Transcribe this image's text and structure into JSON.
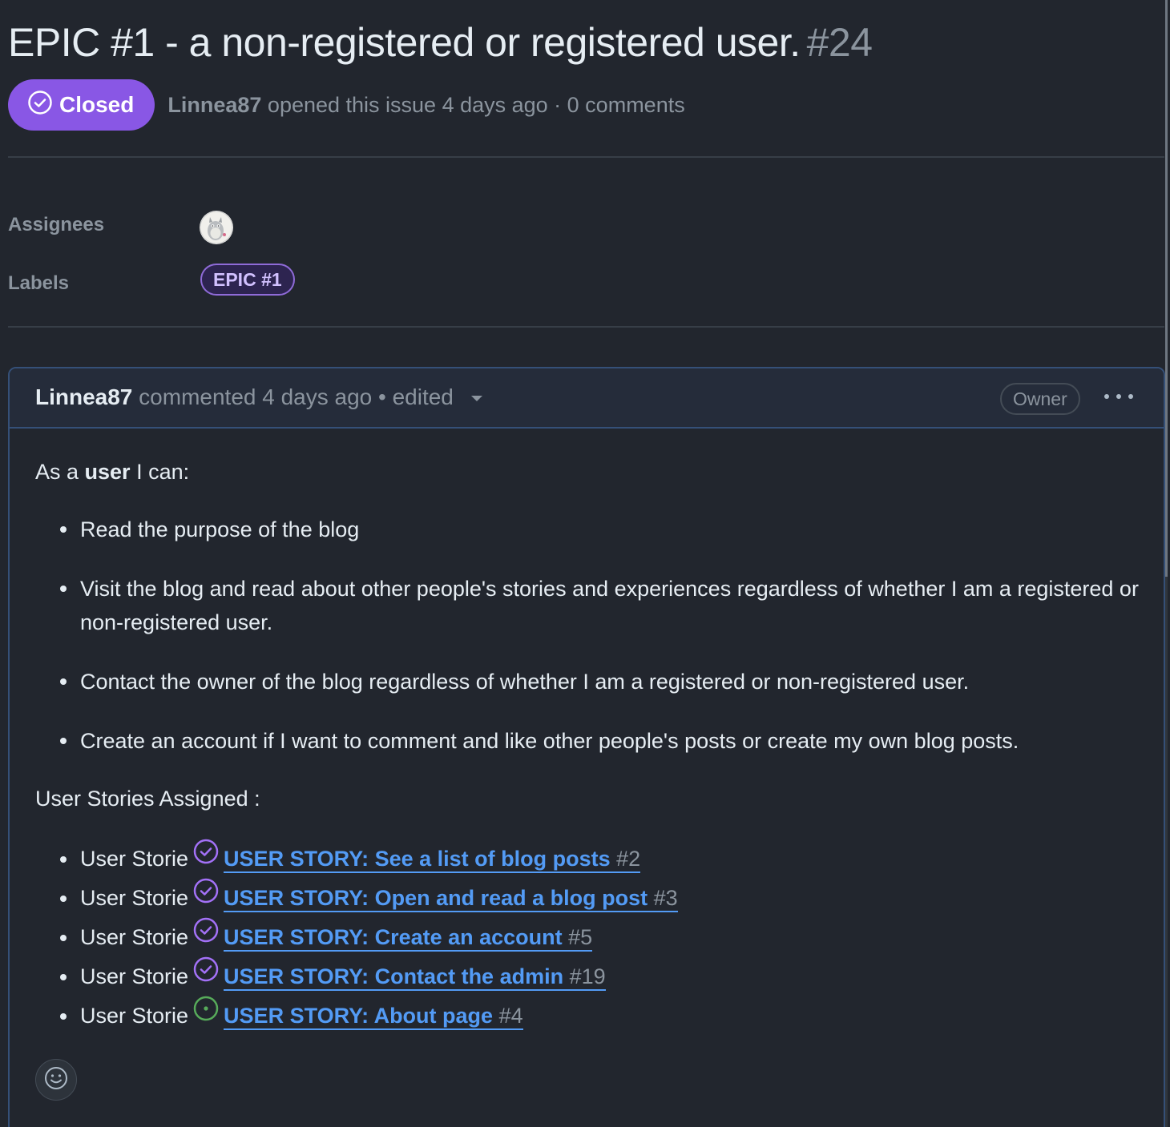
{
  "issue": {
    "title": "EPIC #1 - a non-registered or registered user.",
    "number": "#24",
    "state_label": "Closed",
    "state_color": "#8957e5",
    "author": "Linnea87",
    "meta_text": "opened this issue 4 days ago · 0 comments"
  },
  "sidebar": {
    "assignees_label": "Assignees",
    "labels_label": "Labels",
    "label_name": "EPIC #1",
    "label_color": "#8f6bd8"
  },
  "comment": {
    "author": "Linnea87",
    "meta_text": "commented 4 days ago • edited",
    "role_badge": "Owner",
    "intro_prefix": "As a ",
    "intro_bold": "user",
    "intro_suffix": " I can:",
    "requirements": [
      "Read the purpose of the blog",
      "Visit the blog and read about other people's stories and experiences regardless of whether I am a registered or non-registered user.",
      "Contact the owner of the blog regardless of whether I am a registered or non-registered user.",
      "Create an account if I want to comment and like other people's posts or create my own blog posts."
    ],
    "stories_heading": "User Stories Assigned :",
    "stories": [
      {
        "prefix": "User Storie",
        "title": "USER STORY: See a list of blog posts",
        "number": "#2",
        "state": "closed"
      },
      {
        "prefix": "User Storie",
        "title": "USER STORY: Open and read a blog post",
        "number": "#3",
        "state": "closed"
      },
      {
        "prefix": "User Storie",
        "title": "USER STORY: Create an account ",
        "number": "#5",
        "state": "closed"
      },
      {
        "prefix": "User Storie",
        "title": "USER STORY: Contact the admin ",
        "number": "#19",
        "state": "closed"
      },
      {
        "prefix": "User Storie",
        "title": "USER STORY: About page",
        "number": "#4",
        "state": "open"
      }
    ],
    "icons": {
      "closed": "check-circle-icon",
      "open": "issue-open-icon",
      "reaction": "smiley-icon",
      "menu": "kebab-menu-icon"
    },
    "colors": {
      "closed": "#a371f7",
      "open": "#57ab5a",
      "link": "#539bf5"
    }
  }
}
